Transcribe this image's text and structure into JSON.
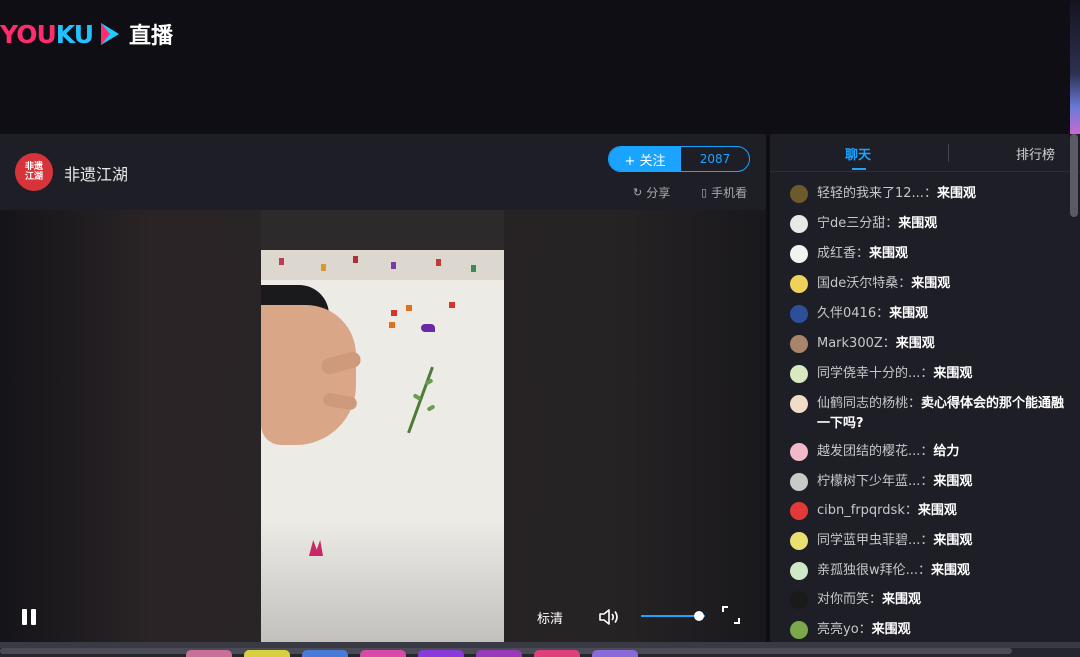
{
  "header": {
    "logo_you": "YOU",
    "logo_ku": "KU",
    "logo_live": "直播"
  },
  "anchor": {
    "avatar_text": "非遗\n江湖",
    "name": "非遗江湖",
    "follow_label": "+ 关注",
    "follow_count": "2087",
    "share_label": "分享",
    "mobile_label": "手机看"
  },
  "player": {
    "quality_label": "标清",
    "volume_percent": 90,
    "state": "playing"
  },
  "chat": {
    "tab_chat": "聊天",
    "tab_rank": "排行榜",
    "messages": [
      {
        "user": "轻轻的我来了12...",
        "text": "来围观",
        "avatar_color": "#6b5a2a"
      },
      {
        "user": "宁de三分甜",
        "text": "来围观",
        "avatar_color": "#e8e8e8"
      },
      {
        "user": "成红香",
        "text": "来围观",
        "avatar_color": "#f2f2f2"
      },
      {
        "user": "国de沃尔特桑",
        "text": "来围观",
        "avatar_color": "#f0d25a"
      },
      {
        "user": "久伴0416",
        "text": "来围观",
        "avatar_color": "#2d4f9a"
      },
      {
        "user": "Mark300Z",
        "text": "来围观",
        "avatar_color": "#a8846a"
      },
      {
        "user": "同学侥幸十分的...",
        "text": "来围观",
        "avatar_color": "#d8e8c0"
      },
      {
        "user": "仙鹤同志的杨桃",
        "text": "卖心得体会的那个能通融一下吗?",
        "avatar_color": "#f2dcc8"
      },
      {
        "user": "越发团结的樱花...",
        "text": "给力",
        "avatar_color": "#f0b8c8"
      },
      {
        "user": "柠檬树下少年蓝...",
        "text": "来围观",
        "avatar_color": "#c9c9c9"
      },
      {
        "user": "cibn_frpqrdsk",
        "text": "来围观",
        "avatar_color": "#e23a3a"
      },
      {
        "user": "同学蓝甲虫菲碧...",
        "text": "来围观",
        "avatar_color": "#e8e070"
      },
      {
        "user": "亲孤独很w拜伦...",
        "text": "来围观",
        "avatar_color": "#d0e8c8"
      },
      {
        "user": "对你而笑",
        "text": "来围观",
        "avatar_color": "#1a1a1a"
      },
      {
        "user": "亮亮yo",
        "text": "来围观",
        "avatar_color": "#7aa84a"
      }
    ]
  },
  "colors": {
    "accent": "#1aa3ff",
    "brand_pink": "#ff2d6e",
    "brand_blue": "#23c2ff"
  }
}
